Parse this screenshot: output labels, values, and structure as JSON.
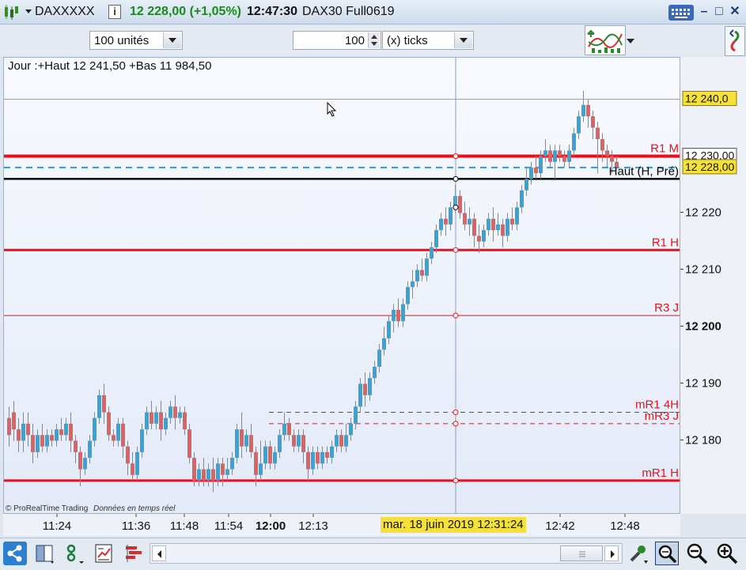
{
  "title_bar": {
    "symbol": "DAXXXXX",
    "price_change": "12 228,00 (+1,05%)",
    "time": "12:47:30",
    "instrument": "DAX30 Full0619"
  },
  "toolbar": {
    "units_select": "100 unités",
    "ticks_value": "100",
    "ticks_select": "(x) ticks"
  },
  "chart": {
    "info": "Jour :+Haut 12 241,50 +Bas 11 984,50",
    "copyright": "© ProRealTime Trading",
    "data_label": "Données en temps réel",
    "cursor_time": "mar. 18 juin 2019 12:31:24"
  },
  "price_axis": {
    "labels": [
      "12 220",
      "12 210",
      "12 200",
      "12 190",
      "12 180"
    ],
    "bold_label": "12 200",
    "tag_high": "12 240,0",
    "tag_r1m": "12 230,00",
    "tag_last": "12 228,00"
  },
  "time_axis": {
    "labels": [
      "11:24",
      "11:36",
      "11:48",
      "11:54",
      "12:00",
      "12:13",
      "12:42",
      "12:48"
    ]
  },
  "levels": [
    {
      "label": "R1 M",
      "value": 12230,
      "color": "#e8111b",
      "width": 4,
      "dash": false
    },
    {
      "label": "Haut (H, Pré)",
      "value": 12226,
      "color": "#000000",
      "width": 2.5,
      "dash": false
    },
    {
      "label": "R1 H",
      "value": 12213.5,
      "color": "#e8111b",
      "width": 3,
      "dash": false
    },
    {
      "label": "R3 J",
      "value": 12202,
      "color": "#e8111b",
      "width": 1,
      "dash": false
    },
    {
      "label": "mR1 4H",
      "value": 12185,
      "color": "#e8111b",
      "width": 1,
      "dash": true
    },
    {
      "label": "mR3 J",
      "value": 12183,
      "color": "#e8111b",
      "width": 1,
      "dash": true
    },
    {
      "label": "mR1 H",
      "value": 12173,
      "color": "#e8111b",
      "width": 3,
      "dash": false
    }
  ],
  "colors": {
    "up": "#3aa3d2",
    "down": "#d86464",
    "last_dash": "#2a9ad0",
    "tag_yellow": "#f5e13a"
  }
}
